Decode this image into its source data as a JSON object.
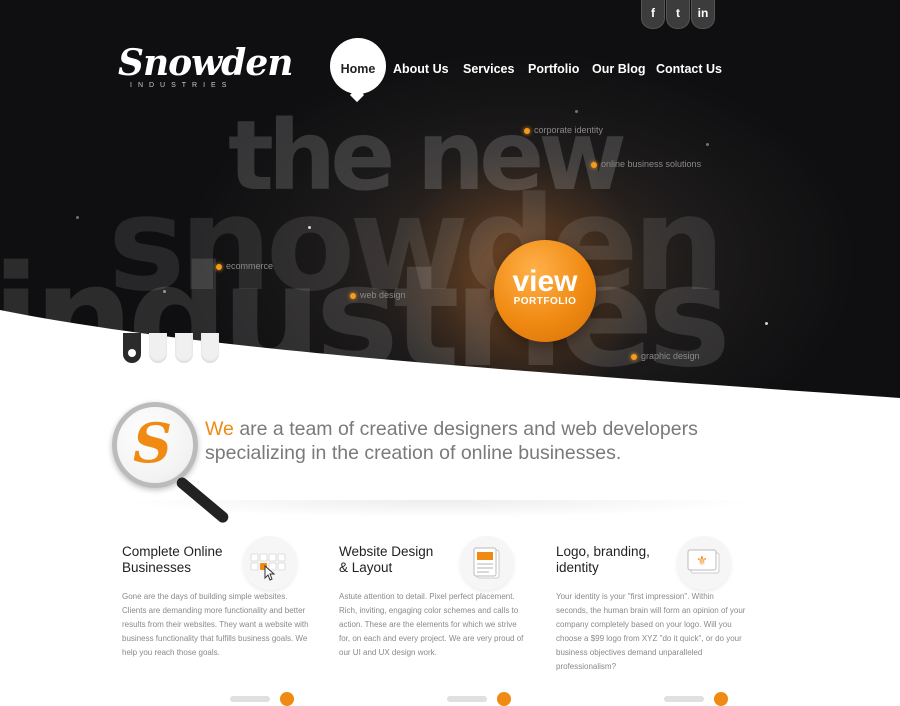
{
  "brand": {
    "name": "Snowden",
    "tagline": "INDUSTRIES"
  },
  "social": [
    {
      "label": "f",
      "icon": "facebook-icon"
    },
    {
      "label": "t",
      "icon": "twitter-icon"
    },
    {
      "label": "in",
      "icon": "linkedin-icon"
    }
  ],
  "nav": {
    "home": "Home",
    "about": "About Us",
    "services": "Services",
    "portfolio": "Portfolio",
    "blog": "Our Blog",
    "contact": "Contact Us"
  },
  "hero": {
    "line1": "the new",
    "line2": "snowden",
    "line3": "industries",
    "tags": {
      "corporate": "corporate identity",
      "online": "online business solutions",
      "ecommerce": "ecommerce",
      "webdesign": "web design",
      "graphic": "graphic design"
    },
    "cta": {
      "line1": "view",
      "line2": "PORTFOLIO"
    }
  },
  "intro": {
    "we": "We",
    "rest1": " are a team of creative designers and web developers",
    "line2": "specializing in the creation of online businesses."
  },
  "services": [
    {
      "title1": "Complete Online",
      "title2": "Businesses",
      "icon": "grid-cursor-icon",
      "body": "Gone are the days of building simple websites. Clients are demanding more functionality and better results from their websites. They want a website with business functionality that fulfills business goals. We help you reach those goals."
    },
    {
      "title1": "Website Design",
      "title2": "& Layout",
      "icon": "document-icon",
      "body": "Astute attention to detail. Pixel perfect placement. Rich, inviting, engaging color schemes and calls to action. These are the elements for which we strive for, on each and every project. We are very proud of our UI and UX design work."
    },
    {
      "title1": "Logo, branding,",
      "title2": "identity",
      "icon": "fleur-card-icon",
      "body": "Your identity is your \"first impression\". Within seconds, the human brain will form an opinion of your company completely based on your logo. Will you choose a $99 logo from XYZ \"do it quick\", or do your business objectives demand unparalleled professionalism?"
    }
  ],
  "colors": {
    "accent": "#f08a12",
    "hero_bg": "#141414"
  }
}
